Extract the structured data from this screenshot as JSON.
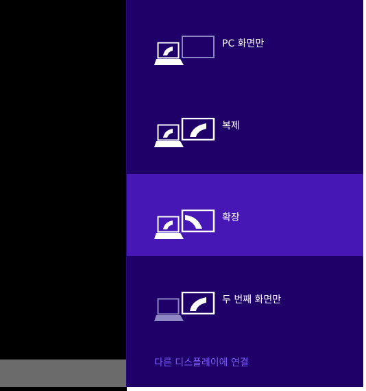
{
  "panel": {
    "options": [
      {
        "label": "PC 화면만",
        "icon": "pc-screen-only-icon"
      },
      {
        "label": "복제",
        "icon": "duplicate-icon"
      },
      {
        "label": "확장",
        "icon": "extend-icon"
      },
      {
        "label": "두 번째 화면만",
        "icon": "second-screen-only-icon"
      }
    ],
    "selected_option": "확장",
    "connect_link": "다른 디스플레이에 연결"
  },
  "colors": {
    "panel_background": "#1f0068",
    "selected_background": "#4617b4",
    "link": "#7d5cff",
    "desktop": "#000000",
    "taskbar": "#6b6b6b"
  }
}
